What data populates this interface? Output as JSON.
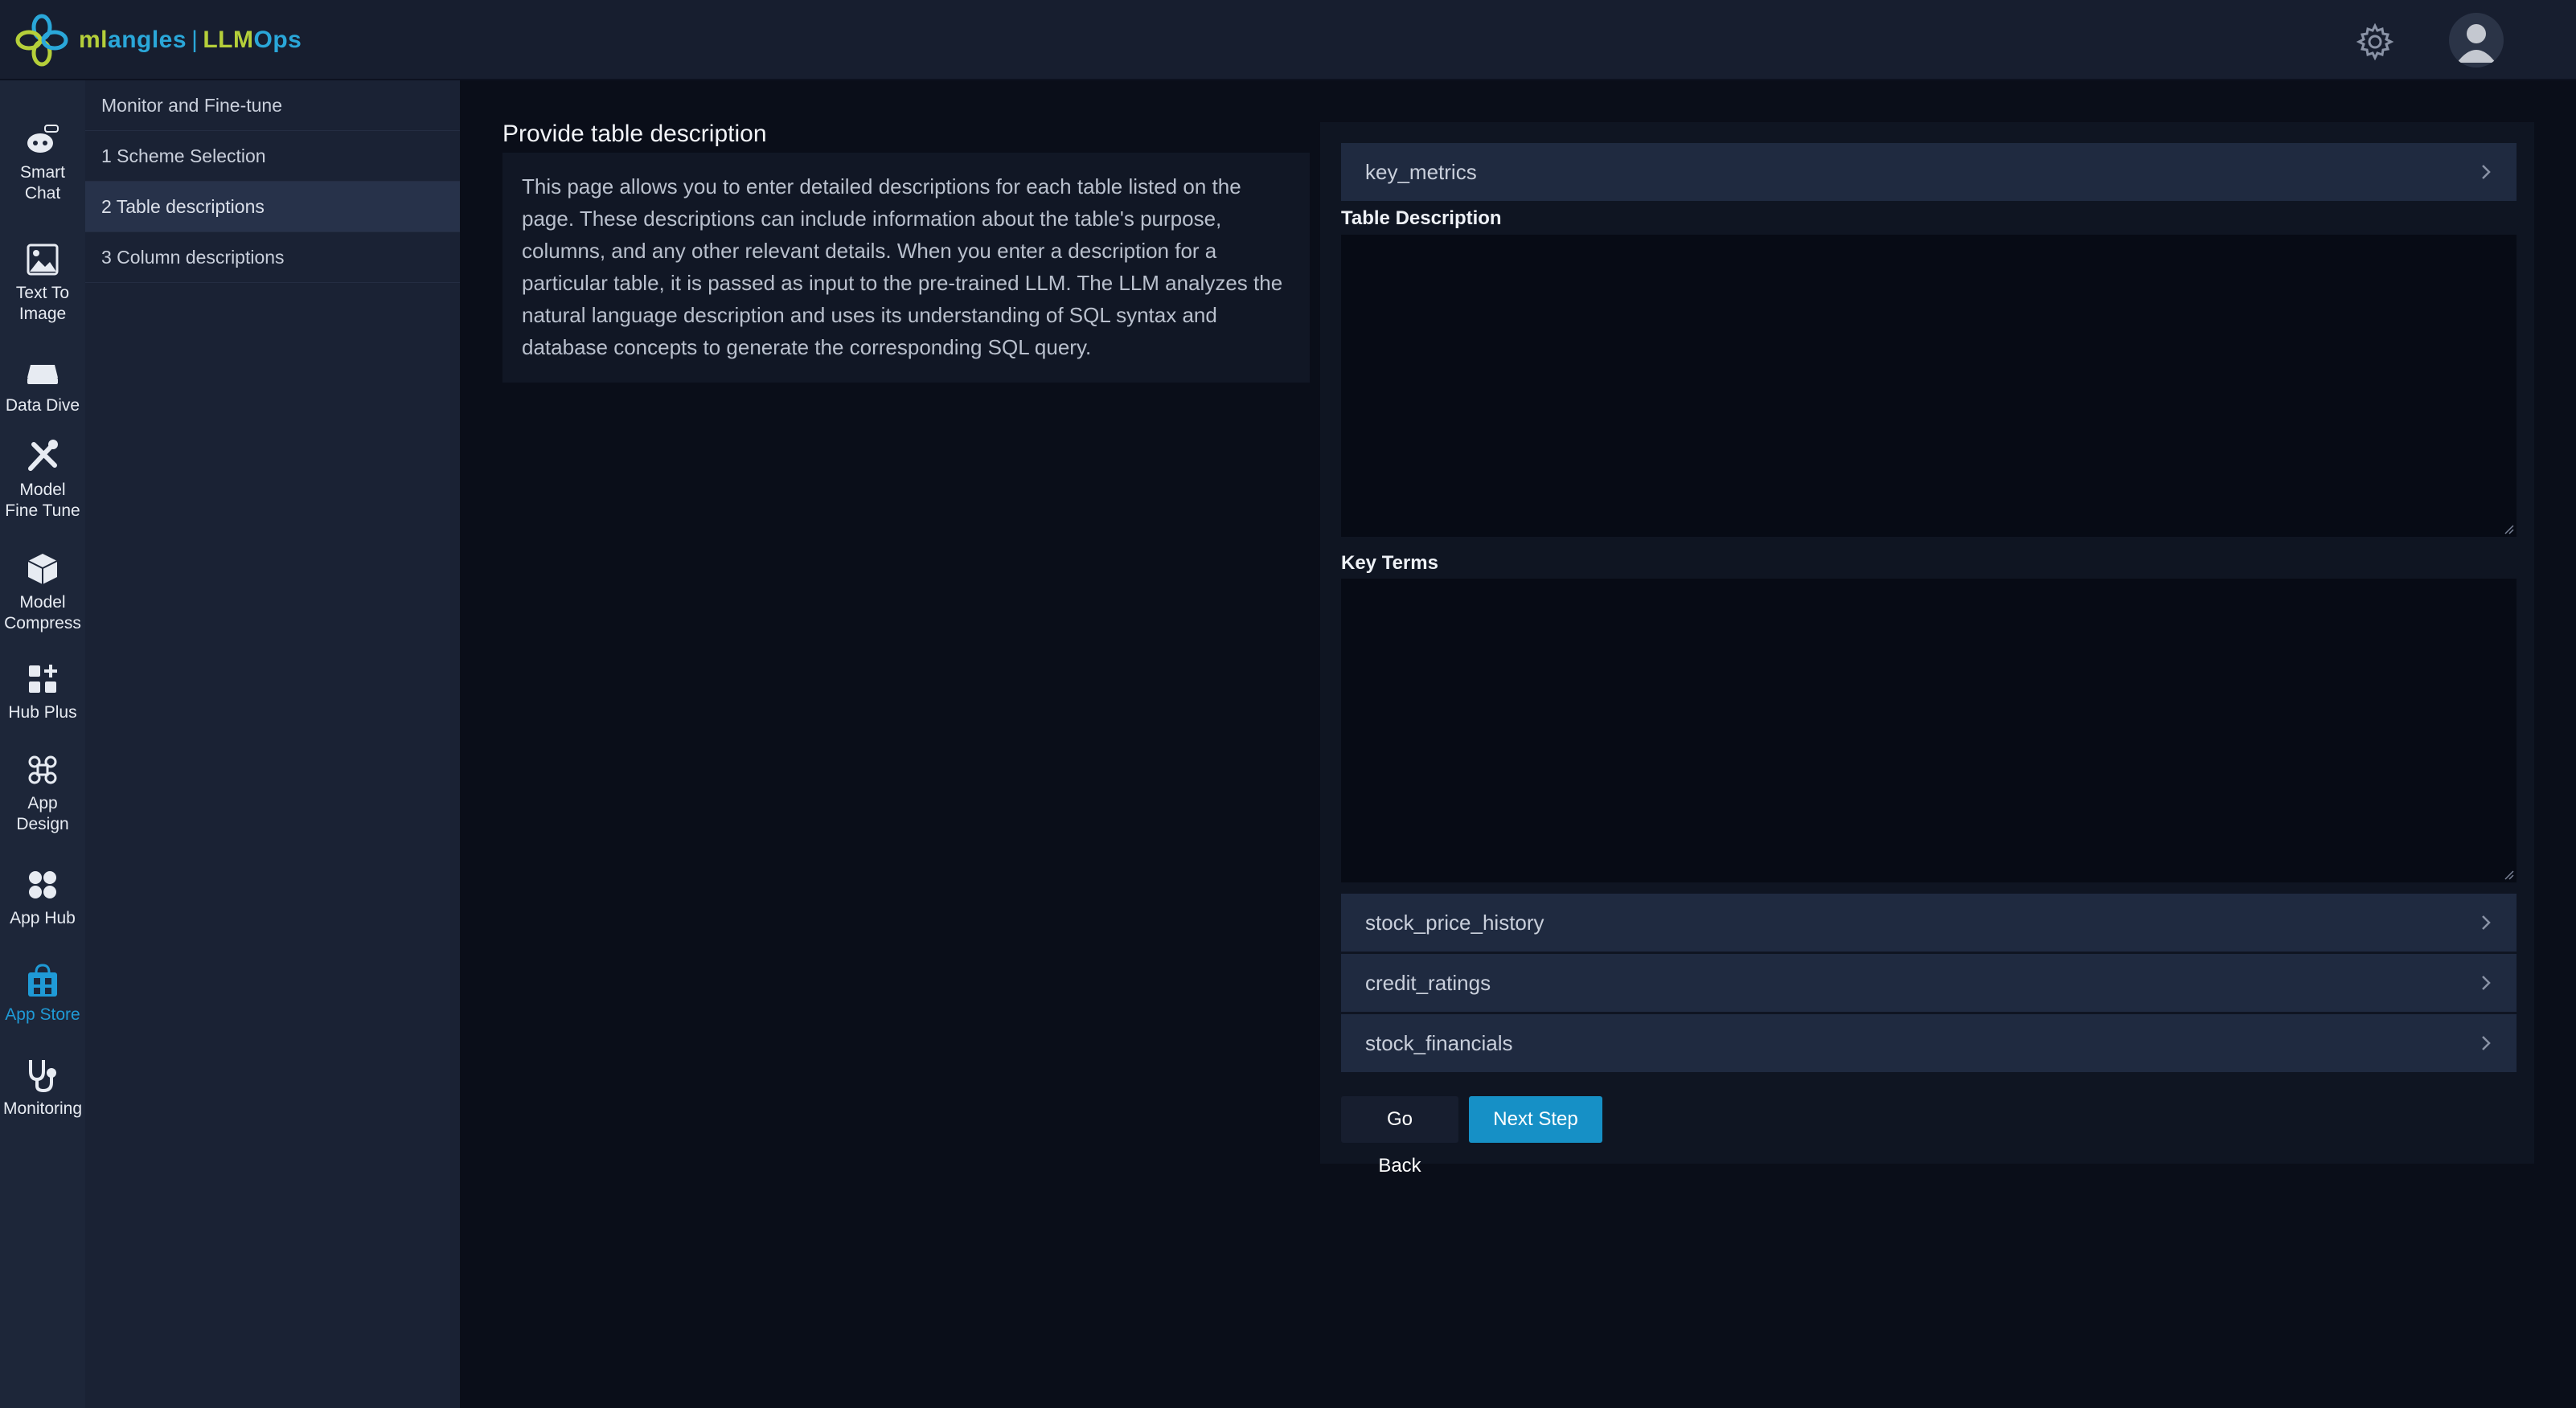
{
  "brand": {
    "ml": "ml",
    "angles": "angles",
    "sep": "|",
    "llm": "LLM",
    "ops": "Ops"
  },
  "colors": {
    "accent": "#1690c6",
    "logo_green": "#b5cf3a",
    "logo_blue": "#2aa7d9"
  },
  "header": {
    "settings_icon": "gear-icon",
    "avatar_icon": "user-avatar"
  },
  "rail": {
    "items": [
      {
        "line1": "Smart",
        "line2": "Chat",
        "icon": "robot-icon"
      },
      {
        "line1": "Text To",
        "line2": "Image",
        "icon": "image-icon"
      },
      {
        "line1": "Data Dive",
        "line2": "",
        "icon": "drive-icon"
      },
      {
        "line1": "Model",
        "line2": "Fine Tune",
        "icon": "tools-icon"
      },
      {
        "line1": "Model",
        "line2": "Compress",
        "icon": "box-icon"
      },
      {
        "line1": "Hub Plus",
        "line2": "",
        "icon": "grid-plus-icon"
      },
      {
        "line1": "App",
        "line2": "Design",
        "icon": "command-icon"
      },
      {
        "line1": "App Hub",
        "line2": "",
        "icon": "apps-icon"
      },
      {
        "line1": "App Store",
        "line2": "",
        "icon": "store-icon"
      },
      {
        "line1": "Monitoring",
        "line2": "",
        "icon": "stethoscope-icon"
      }
    ]
  },
  "steps": {
    "header": "Monitor and Fine-tune",
    "items": [
      "1 Scheme Selection",
      "2 Table descriptions",
      "3 Column descriptions"
    ]
  },
  "main": {
    "title": "Provide table description",
    "description": "This page allows you to enter detailed descriptions for each table listed on the page. These descriptions can include information about the table's purpose, columns, and any other relevant details. When you enter a description for a particular table, it is passed as input to the pre-trained LLM. The LLM analyzes the natural language description and uses its understanding of SQL syntax and database concepts to generate the corresponding SQL query."
  },
  "form": {
    "tables": [
      "key_metrics",
      "stock_price_history",
      "credit_ratings",
      "stock_financials"
    ],
    "table_description_label": "Table Description",
    "table_description_value": "",
    "key_terms_label": "Key Terms",
    "key_terms_value": "",
    "go_back": "Go Back",
    "next_step": "Next Step"
  }
}
